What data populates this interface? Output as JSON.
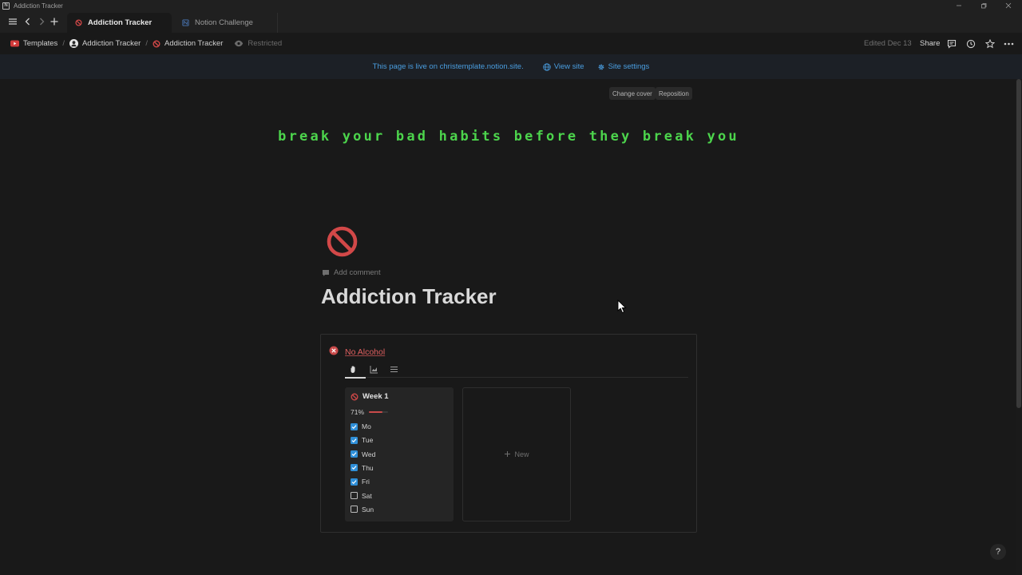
{
  "window": {
    "title": "Addiction Tracker"
  },
  "tabs": [
    {
      "label": "Addiction Tracker"
    },
    {
      "label": "Notion Challenge"
    }
  ],
  "breadcrumb": [
    {
      "label": "Templates"
    },
    {
      "label": "Addiction Tracker"
    },
    {
      "label": "Addiction Tracker"
    }
  ],
  "access": {
    "label": "Restricted"
  },
  "topbar": {
    "edited": "Edited Dec 13",
    "share": "Share"
  },
  "banner": {
    "message": "This page is live on christemplate.notion.site.",
    "view_site": "View site",
    "site_settings": "Site settings"
  },
  "cover": {
    "change_cover": "Change cover",
    "reposition": "Reposition",
    "text": "break your bad habits before they break you"
  },
  "page": {
    "add_comment": "Add comment",
    "title": "Addiction Tracker"
  },
  "habit": {
    "name": "No Alcohol",
    "card": {
      "title": "Week 1",
      "progress_label": "71%",
      "progress": 0.71,
      "days": [
        {
          "label": "Mo",
          "checked": true
        },
        {
          "label": "Tue",
          "checked": true
        },
        {
          "label": "Wed",
          "checked": true
        },
        {
          "label": "Thu",
          "checked": true
        },
        {
          "label": "Fri",
          "checked": true
        },
        {
          "label": "Sat",
          "checked": false
        },
        {
          "label": "Sun",
          "checked": false
        }
      ]
    },
    "new_label": "New"
  },
  "help": {
    "label": "?"
  },
  "colors": {
    "accent": "#2f8fd8",
    "cover_text": "#4cd44c",
    "danger": "#e06060",
    "banner_link": "#4a9ee0"
  }
}
